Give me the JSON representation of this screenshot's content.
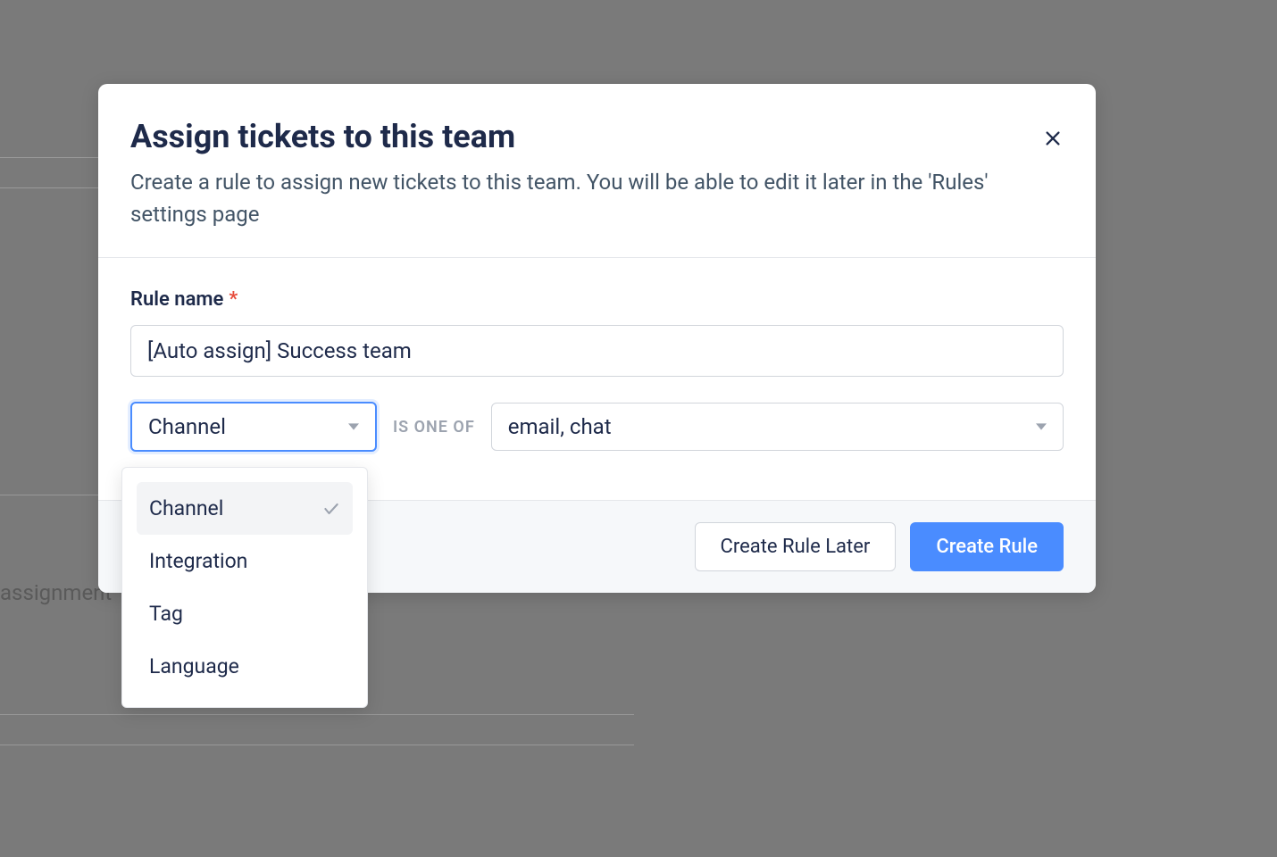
{
  "background": {
    "text_fragment": "assignment"
  },
  "modal": {
    "title": "Assign tickets to this team",
    "subtitle": "Create a rule to assign new tickets to this team. You will be able to edit it later in the 'Rules' settings page",
    "rule_name_label": "Rule name",
    "required_marker": "*",
    "rule_name_value": "[Auto assign] Success team",
    "condition": {
      "field_selected": "Channel",
      "operator_text": "IS ONE OF",
      "value_display": "email, chat",
      "options": [
        {
          "label": "Channel",
          "selected": true
        },
        {
          "label": "Integration",
          "selected": false
        },
        {
          "label": "Tag",
          "selected": false
        },
        {
          "label": "Language",
          "selected": false
        }
      ]
    },
    "buttons": {
      "later_label": "Create Rule Later",
      "create_label": "Create Rule"
    }
  }
}
